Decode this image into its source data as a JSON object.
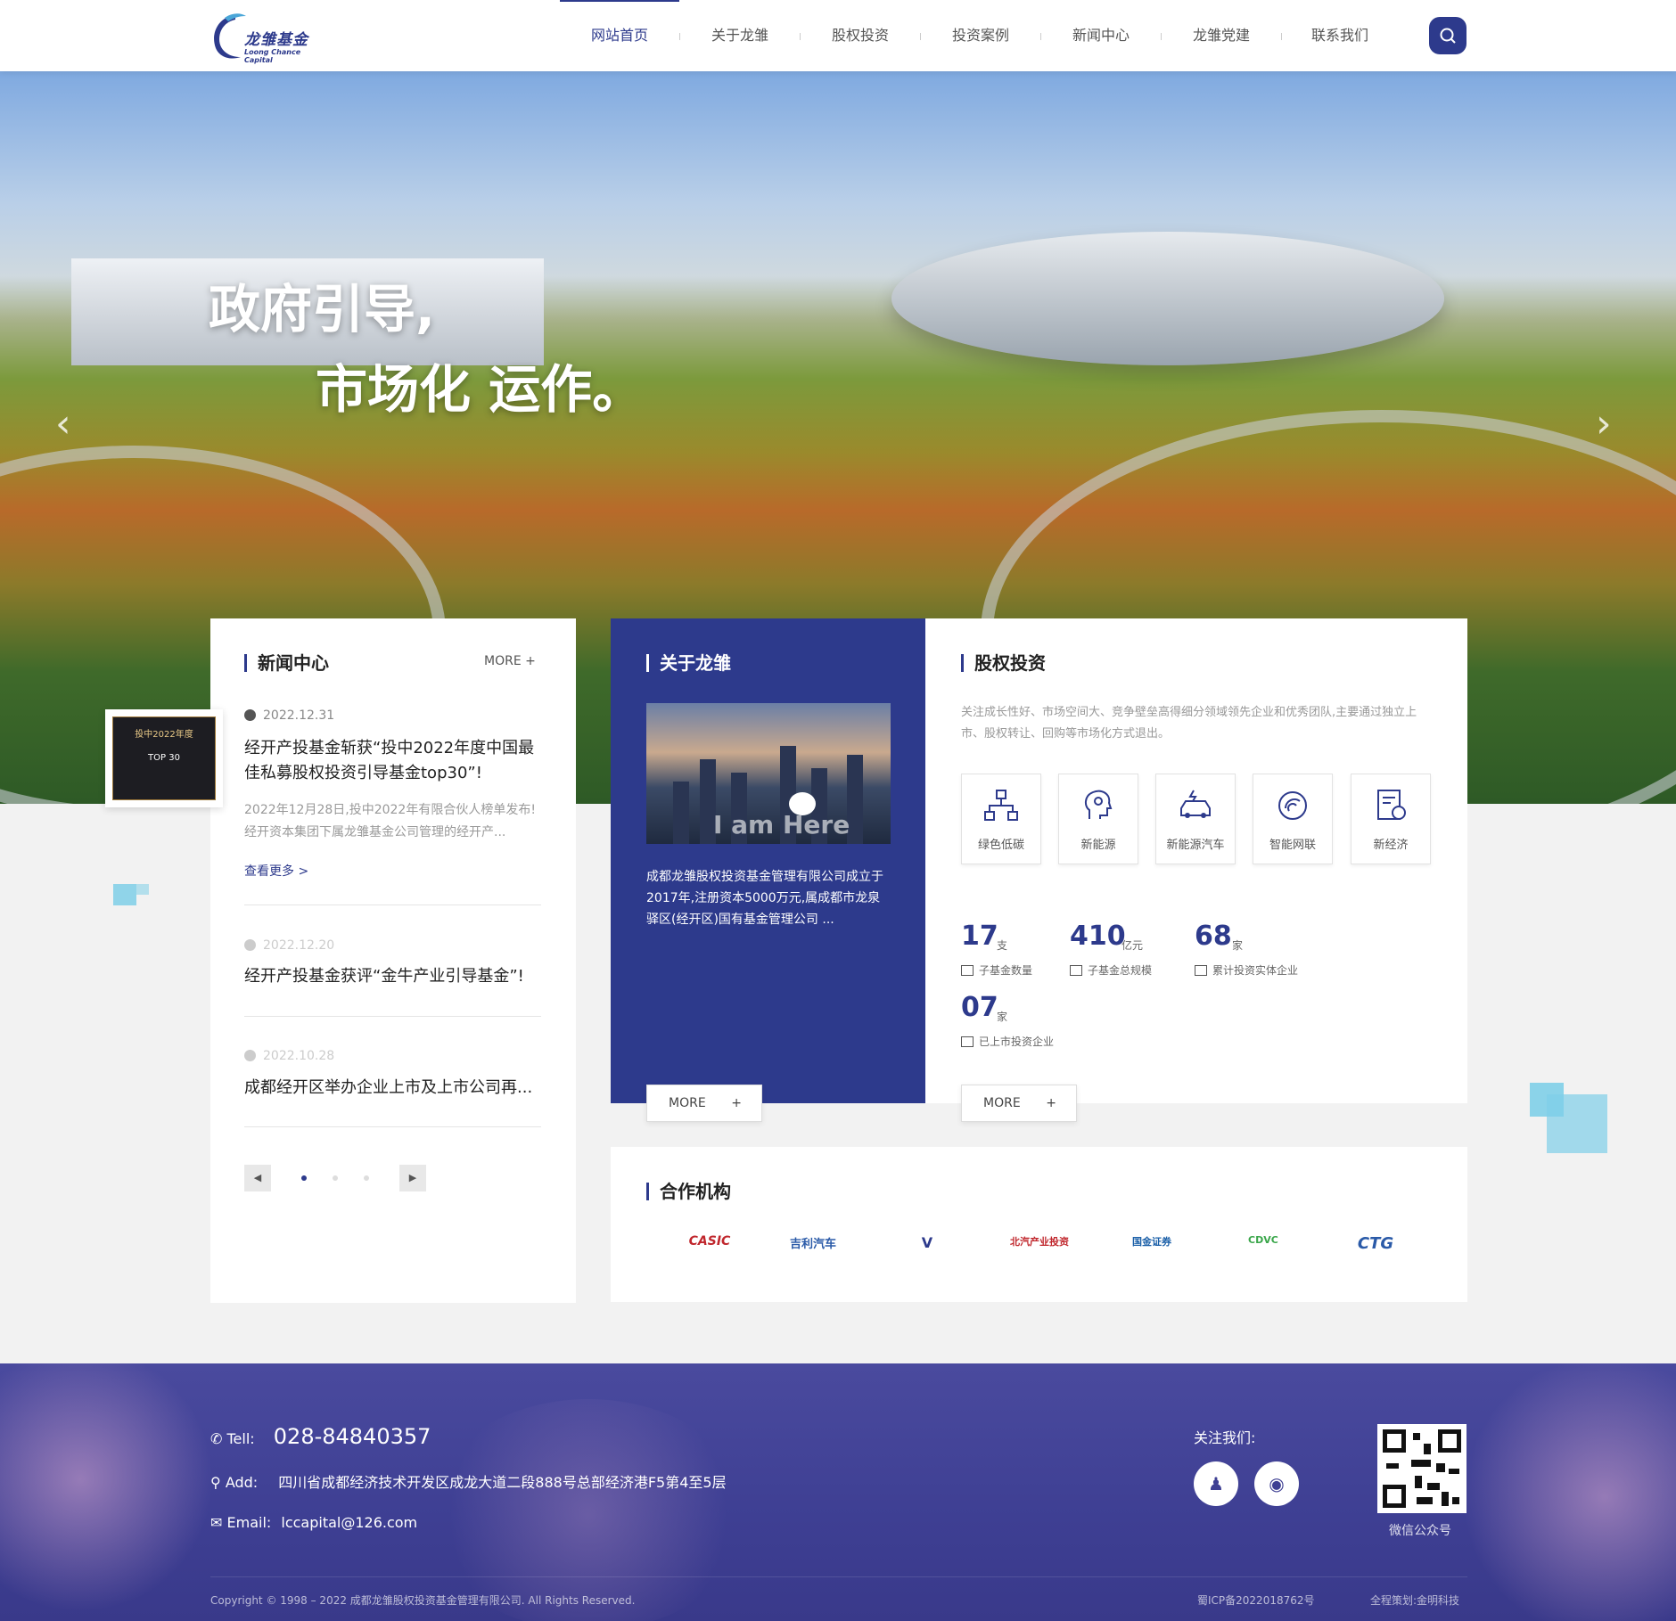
{
  "header": {
    "logo_text": "龙雏基金",
    "logo_en": "Loong Chance Capital",
    "nav": [
      {
        "label": "网站首页",
        "active": true
      },
      {
        "label": "关于龙雏"
      },
      {
        "label": "股权投资"
      },
      {
        "label": "投资案例"
      },
      {
        "label": "新闻中心"
      },
      {
        "label": "龙雏党建"
      },
      {
        "label": "联系我们"
      }
    ],
    "search_icon": "search-icon"
  },
  "banner": {
    "line1": "政府引导,",
    "line2": "市场化  运作。",
    "prev_icon": "chevron-left-icon",
    "next_icon": "chevron-right-icon"
  },
  "news": {
    "title": "新闻中心",
    "more": "MORE  +",
    "items": [
      {
        "date": "2022.12.31",
        "title": "经开产投基金斩获“投中2022年度中国最佳私募股权投资引导基金top30”!",
        "summary": "2022年12月28日,投中2022年有限合伙人榜单发布!经开资本集团下属龙雏基金公司管理的经开产...",
        "read_more": "查看更多  >"
      },
      {
        "date": "2022.12.20",
        "title": "经开产投基金获评“金牛产业引导基金”!"
      },
      {
        "date": "2022.10.28",
        "title": "成都经开区举办企业上市及上市公司再..."
      }
    ],
    "thumb_text": [
      "投中2022年度",
      "TOP 30"
    ]
  },
  "about": {
    "title": "关于龙雏",
    "text": "成都龙雏股权投资基金管理有限公司成立于2017年,注册资本5000万元,属成都市龙泉驿区(经开区)国有基金管理公司 ...",
    "image_caption": "I am Here",
    "more": "MORE"
  },
  "equity": {
    "title": "股权投资",
    "desc": "关注成长性好、市场空间大、竞争壁垒高得细分领域领先企业和优秀团队,主要通过独立上市、股权转让、回购等市场化方式退出。",
    "sectors": [
      "绿色低碳",
      "新能源",
      "新能源汽车",
      "智能网联",
      "新经济"
    ],
    "stats": [
      {
        "num": "17",
        "unit": "支",
        "label": "子基金数量"
      },
      {
        "num": "410",
        "unit": "亿元",
        "label": "子基金总规模"
      },
      {
        "num": "68",
        "unit": "家",
        "label": "累计投资实体企业"
      },
      {
        "num": "07",
        "unit": "家",
        "label": "已上市投资企业"
      }
    ],
    "more": "MORE"
  },
  "partners": {
    "title": "合作机构",
    "logos": [
      "CASIC",
      "吉利汽车",
      "V",
      "北汽产业投资",
      "国金证券",
      "CDVC",
      "CTG"
    ]
  },
  "footer": {
    "tel_label": "Tell:",
    "tel": "028-84840357",
    "add_label": "Add:",
    "address": "四川省成都经济技术开发区成龙大道二段888号总部经济港F5第4至5层",
    "email_label": "Email:",
    "email": "lccapital@126.com",
    "follow": "关注我们:",
    "qr_caption": "微信公众号",
    "copyright": "Copyright © 1998 – 2022 成都龙雏股权投资基金管理有限公司. All Rights Reserved.",
    "icp": "蜀ICP备2022018762号",
    "credit": "全程策划:金明科技",
    "colors": {
      "accent": "#2d3a8c",
      "footer": "#3e3f93"
    }
  }
}
